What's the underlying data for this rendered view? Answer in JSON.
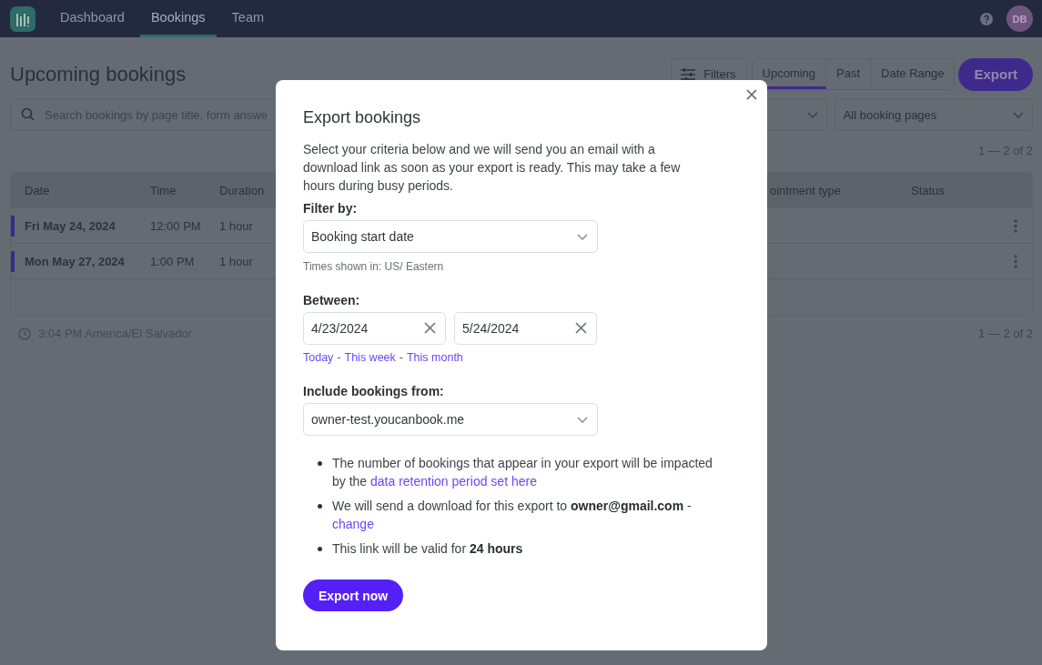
{
  "nav": {
    "items": [
      {
        "label": "Dashboard",
        "selected": false
      },
      {
        "label": "Bookings",
        "selected": true
      },
      {
        "label": "Team",
        "selected": false
      }
    ],
    "avatar": "DB"
  },
  "page": {
    "title": "Upcoming bookings",
    "filters_button": "Filters",
    "range_tabs": [
      {
        "label": "Upcoming",
        "selected": true
      },
      {
        "label": "Past",
        "selected": false
      },
      {
        "label": "Date Range",
        "selected": false
      }
    ],
    "export_button": "Export",
    "search": {
      "placeholder": "Search bookings by page title, form answe"
    },
    "pages_select": {
      "value": "All booking pages"
    },
    "pagination_top": "1 — 2 of 2",
    "table": {
      "columns": [
        "Date",
        "Time",
        "Duration",
        "ointment type",
        "Status"
      ],
      "rows": [
        {
          "date": "Fri May 24, 2024",
          "time": "12:00 PM",
          "duration": "1 hour"
        },
        {
          "date": "Mon May 27, 2024",
          "time": "1:00 PM",
          "duration": "1 hour"
        }
      ]
    },
    "timezone": "3:04 PM America/El Salvador",
    "pagination_bottom": "1 — 2 of 2"
  },
  "dialog": {
    "title": "Export bookings",
    "intro": "Select your criteria below and we will send you an email with a download link as soon as your export is ready. This may take a few hours during busy periods.",
    "filter_label": "Filter by:",
    "filter_value": "Booking start date",
    "timezone_hint": "Times shown in: US/ Eastern",
    "between_label": "Between:",
    "start_date": "4/23/2024",
    "end_date": "5/24/2024",
    "quick_links": [
      "Today",
      "This week",
      "This month"
    ],
    "quick_separator": "-",
    "include_label": "Include bookings from:",
    "include_value": "owner-test.youcanbook.me",
    "notes": [
      {
        "text": "The number of bookings that appear in your export will be impacted by the ",
        "link": "data retention period set here"
      },
      {
        "text": "We will send a download for this export to **owner@gmail.com** - ",
        "link": "change"
      },
      {
        "text": "This link will be valid for **24 hours**"
      }
    ],
    "submit": "Export now"
  }
}
